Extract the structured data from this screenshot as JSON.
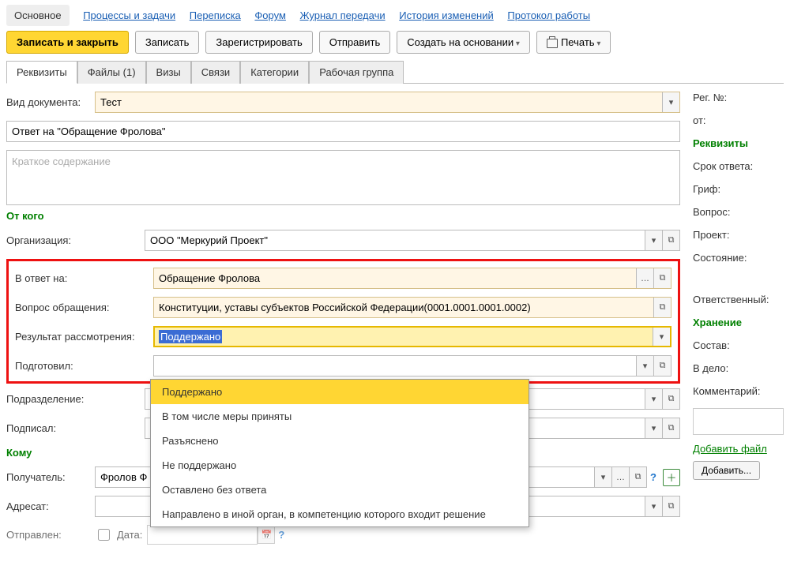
{
  "nav": {
    "active": "Основное",
    "items": [
      "Процессы и задачи",
      "Переписка",
      "Форум",
      "Журнал передачи",
      "История изменений",
      "Протокол работы"
    ]
  },
  "toolbar": {
    "save_close": "Записать и закрыть",
    "save": "Записать",
    "register": "Зарегистрировать",
    "send": "Отправить",
    "create_based": "Создать на основании",
    "print": "Печать"
  },
  "tabs": [
    "Реквизиты",
    "Файлы (1)",
    "Визы",
    "Связи",
    "Категории",
    "Рабочая группа"
  ],
  "form": {
    "doc_kind_label": "Вид документа:",
    "doc_kind_value": "Тест",
    "subject_value": "Ответ на \"Обращение Фролова\"",
    "summary_placeholder": "Краткое содержание",
    "from_head": "От кого",
    "org_label": "Организация:",
    "org_value": "ООО \"Меркурий Проект\"",
    "reply_to_label": "В ответ на:",
    "reply_to_value": "Обращение Фролова",
    "issue_label": "Вопрос обращения:",
    "issue_value": "Конституции, уставы субъектов Российской Федерации(0001.0001.0001.0002)",
    "result_label": "Результат рассмотрения:",
    "result_value": "Поддержано",
    "prepared_label": "Подготовил:",
    "dept_label": "Подразделение:",
    "signed_label": "Подписал:",
    "to_head": "Кому",
    "recipient_label": "Получатель:",
    "recipient_value": "Фролов Ф",
    "addressee_label": "Адресат:",
    "sent_label": "Отправлен:",
    "date_label": "Дата:"
  },
  "dropdown": {
    "items": [
      "Поддержано",
      "В том числе меры приняты",
      "Разъяснено",
      "Не поддержано",
      "Оставлено без ответа",
      "Направлено в иной орган, в компетенцию которого входит решение"
    ]
  },
  "side": {
    "reg_no": "Рег. №:",
    "from": "от:",
    "reqs": "Реквизиты",
    "reply_due": "Срок ответа:",
    "grif": "Гриф:",
    "question": "Вопрос:",
    "project": "Проект:",
    "state": "Состояние:",
    "responsible": "Ответственный:",
    "storage": "Хранение",
    "content": "Состав:",
    "to_case": "В дело:",
    "comment": "Комментарий:",
    "add_file": "Добавить файл",
    "add_btn": "Добавить..."
  }
}
